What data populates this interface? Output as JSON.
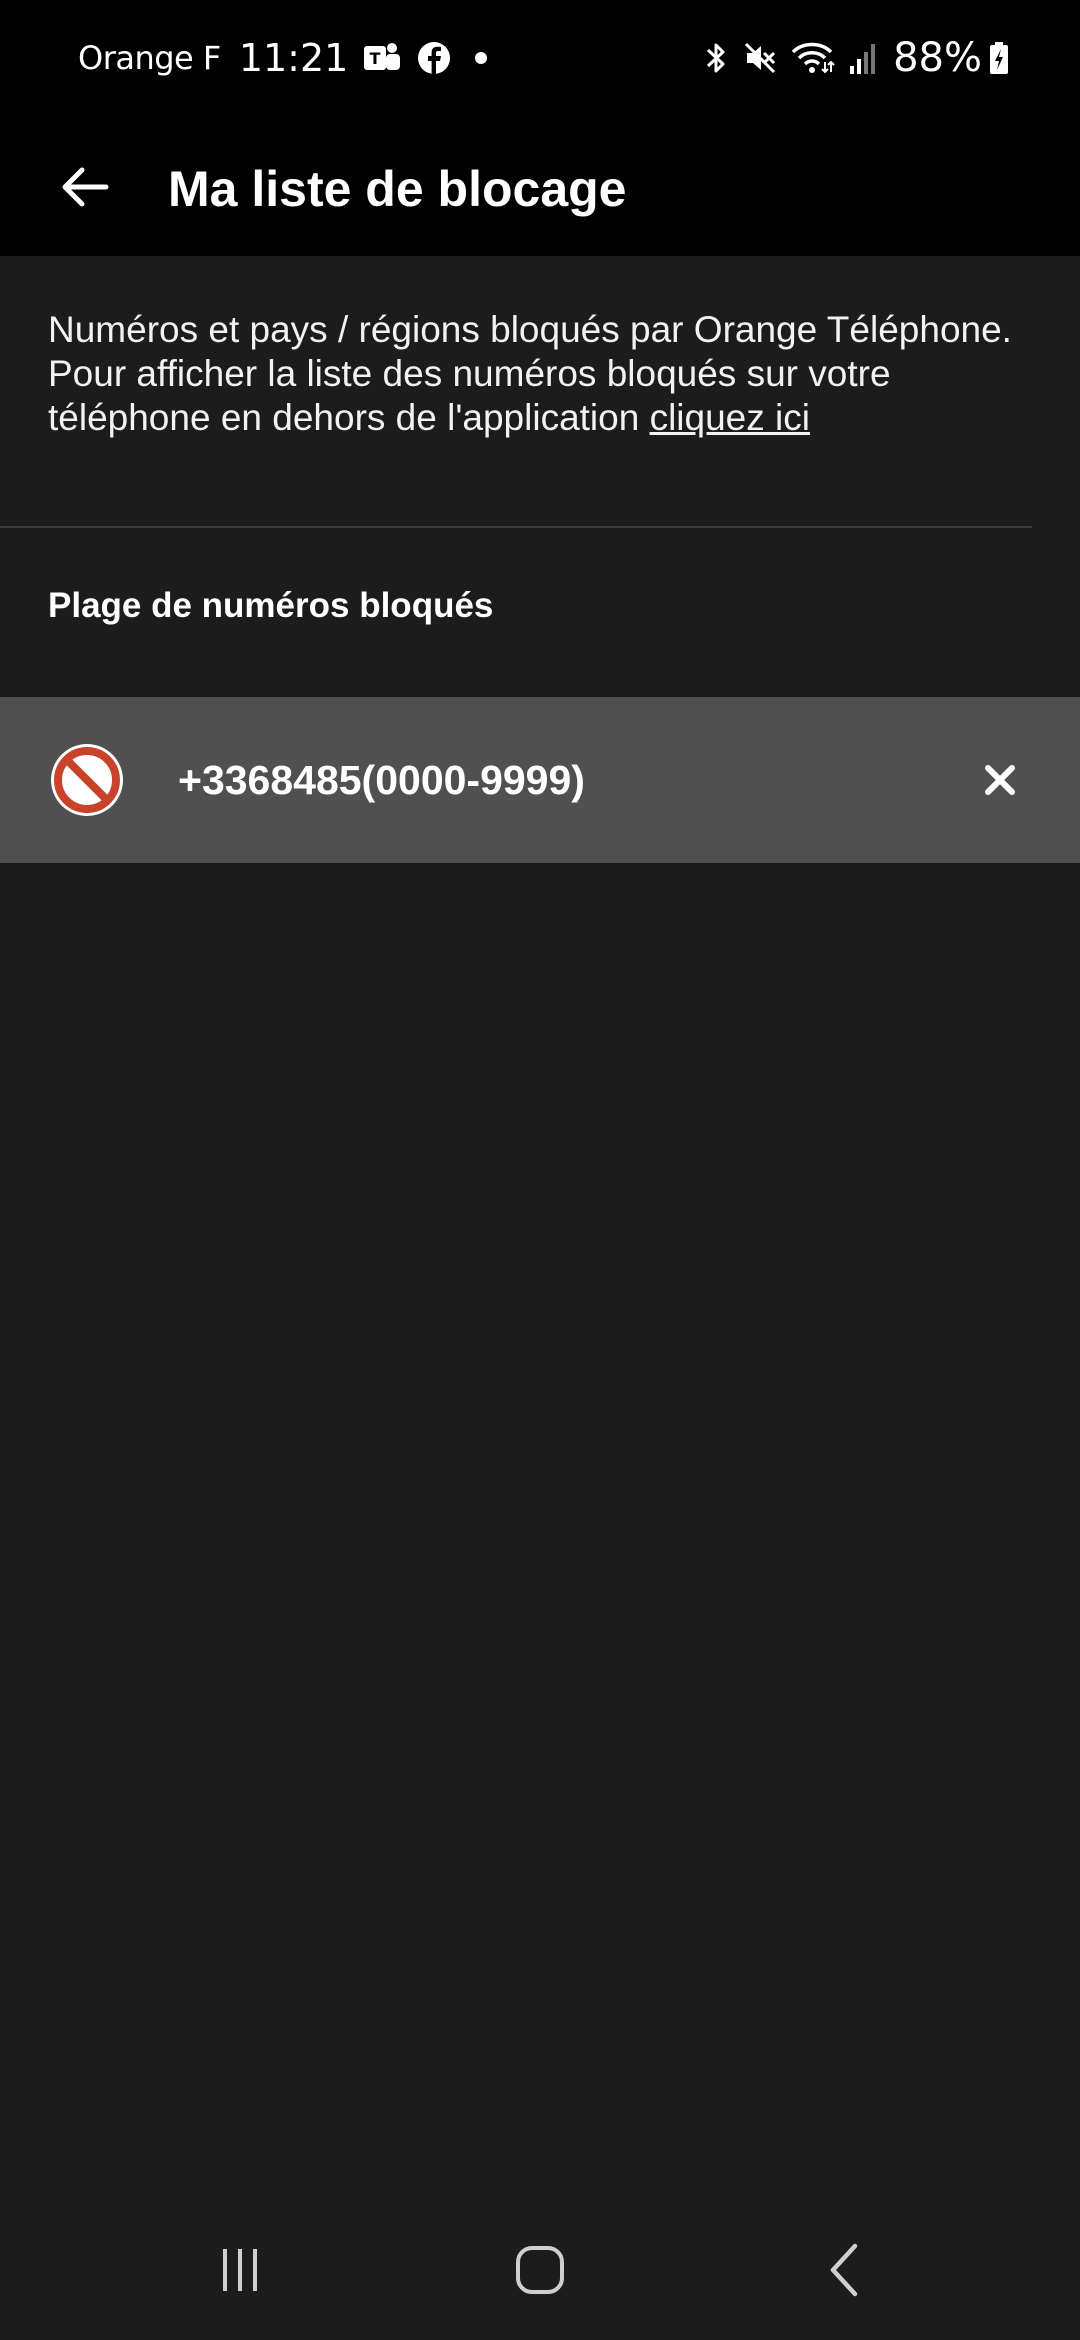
{
  "status_bar": {
    "carrier": "Orange F",
    "time": "11:21",
    "notification_icons": [
      "teams-icon",
      "facebook-icon",
      "dot-icon"
    ],
    "system_icons": [
      "bluetooth-icon",
      "mute-icon",
      "wifi-icon",
      "signal-icon"
    ],
    "battery": "88%"
  },
  "app_bar": {
    "title": "Ma liste de blocage"
  },
  "description": {
    "text": "Numéros et pays / régions bloqués par Orange Téléphone. Pour afficher la liste des numéros bloqués sur votre téléphone en dehors de l'application ",
    "link": "cliquez ici"
  },
  "section": {
    "header": "Plage de numéros bloqués"
  },
  "blocked_items": [
    {
      "number": "+3368485(0000-9999)"
    }
  ],
  "colors": {
    "background": "#1c1c1c",
    "bar": "#000000",
    "row": "#505050",
    "block_icon": "#c8432a"
  }
}
